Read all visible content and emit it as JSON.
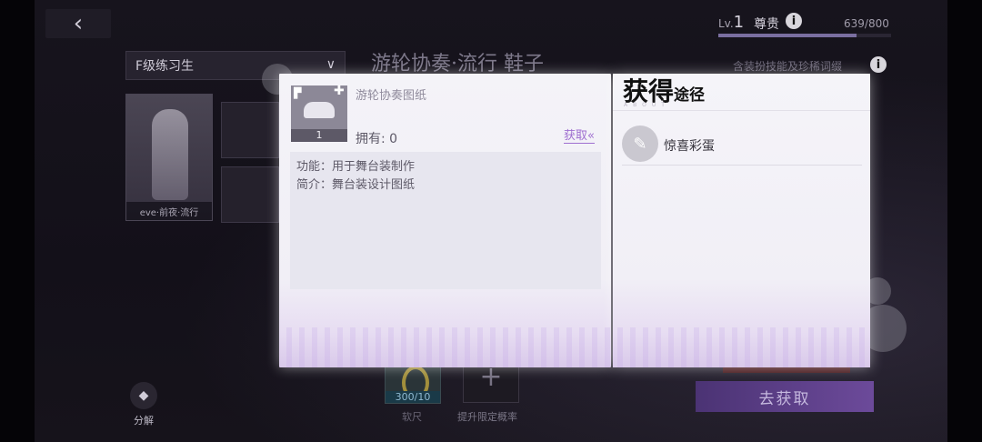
{
  "top": {
    "back_icon": "chevron-left",
    "level_prefix": "Lv.",
    "level": "1",
    "rank": "尊贵",
    "xp": "639/800",
    "xp_fraction": 0.8
  },
  "underlay": {
    "grade": "F级练习生",
    "card_label": "eve·前夜·流行",
    "title": "游轮协奏·流行 鞋子",
    "note": "含装扮技能及珍稀词缀",
    "decompose": "分解",
    "ruler_count": "300/10",
    "ruler_label": "软尺",
    "plus_label": "提升限定概率",
    "obtain_button": "去获取"
  },
  "item": {
    "name": "游轮协奏图纸",
    "count": "1",
    "owned_label": "拥有:",
    "owned_value": "0",
    "get_link": "获取",
    "function_line": "功能：用于舞台装制作",
    "intro_line": "简介：舞台装设计图纸"
  },
  "sources": {
    "title_big": "获得",
    "title_small": "途径",
    "subtitle": "ABOUT",
    "items": [
      {
        "icon": "gift-icon",
        "label": "惊喜彩蛋"
      }
    ]
  }
}
